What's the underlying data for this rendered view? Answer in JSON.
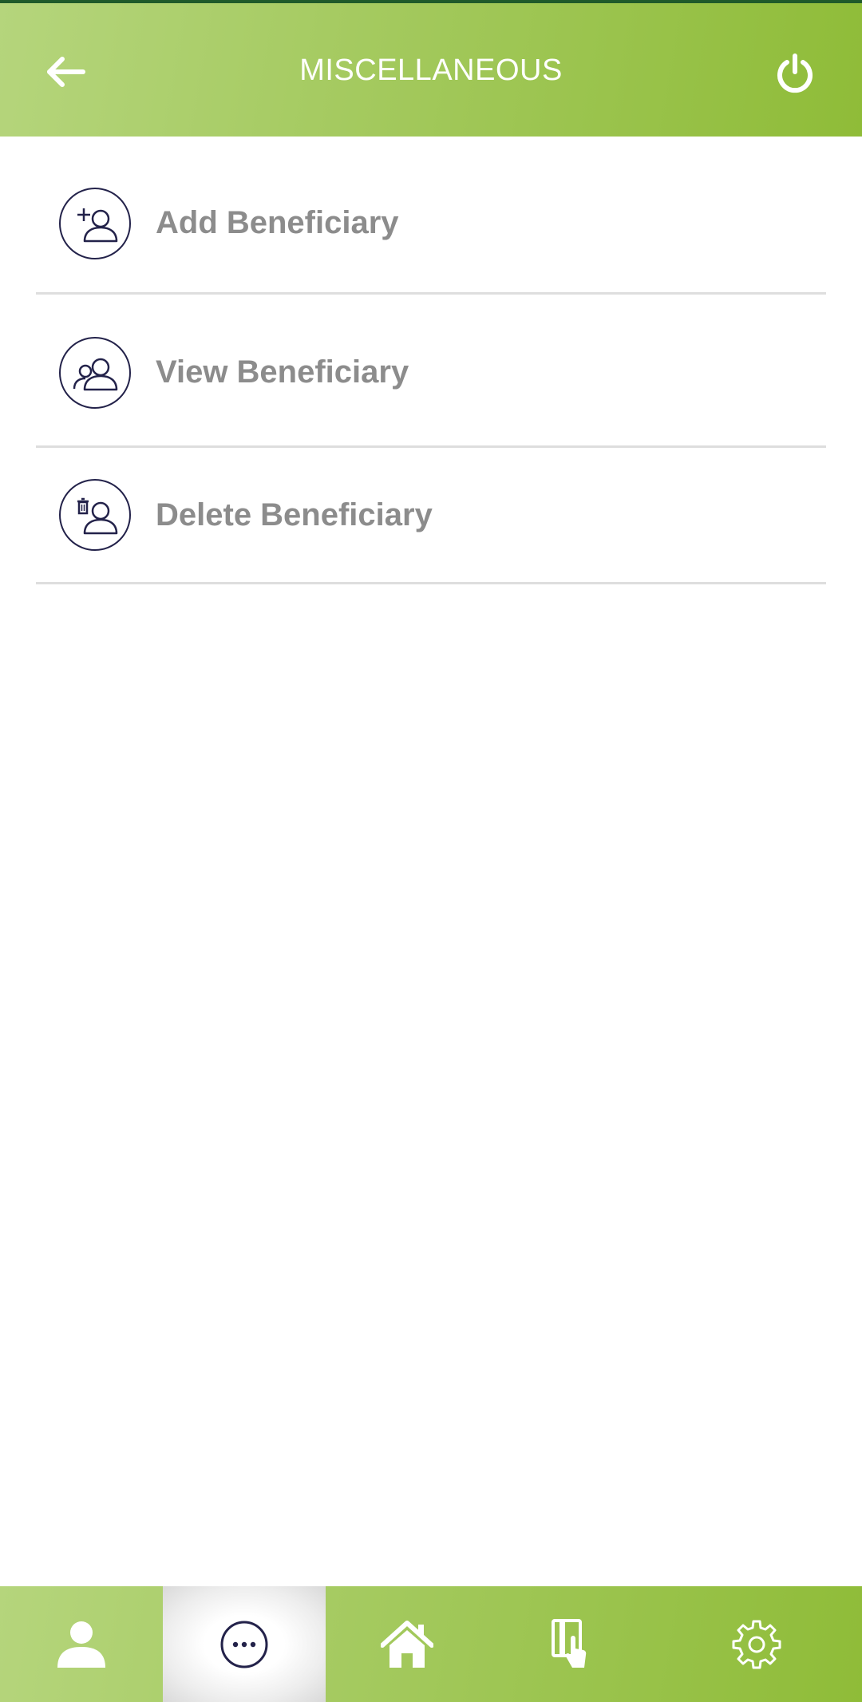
{
  "header": {
    "title": "MISCELLANEOUS",
    "back_icon": "arrow-left-icon",
    "power_icon": "power-icon"
  },
  "colors": {
    "header_gradient_start": "#b5d57c",
    "header_gradient_end": "#8fbc38",
    "icon_outline": "#23224a",
    "label_text": "#8c8c8c",
    "divider": "#dedede"
  },
  "menu": {
    "items": [
      {
        "label": "Add Beneficiary",
        "icon": "add-user-icon"
      },
      {
        "label": "View Beneficiary",
        "icon": "users-icon"
      },
      {
        "label": "Delete Beneficiary",
        "icon": "delete-user-icon"
      }
    ]
  },
  "bottom_nav": {
    "items": [
      {
        "icon": "profile-icon"
      },
      {
        "icon": "more-icon",
        "active": true
      },
      {
        "icon": "home-icon"
      },
      {
        "icon": "card-tap-icon"
      },
      {
        "icon": "gear-icon"
      }
    ]
  }
}
